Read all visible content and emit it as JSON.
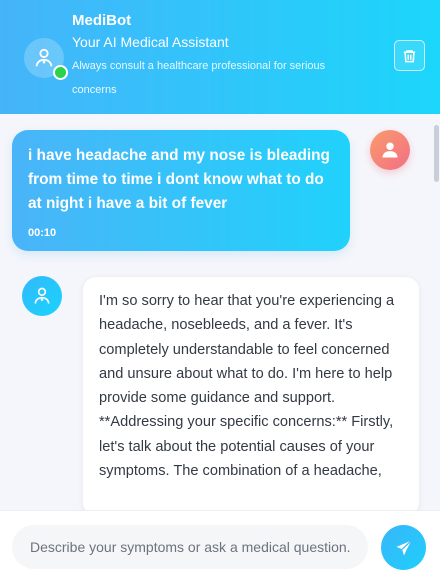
{
  "header": {
    "app_name": "MediBot",
    "subtitle": "Your AI Medical Assistant",
    "disclaimer": "Always consult a healthcare professional for serious concerns",
    "status": "online",
    "clear_icon": "trash-icon"
  },
  "messages": [
    {
      "sender": "user",
      "avatar_icon": "user-icon",
      "text": "i have headache and my nose is bleading from time to time i dont know what to do at night i have a bit of fever",
      "time": "00:10"
    },
    {
      "sender": "bot",
      "avatar_icon": "doctor-icon",
      "text": "I'm so sorry to hear that you're experiencing a headache, nosebleeds, and a fever. It's completely understandable to feel concerned and unsure about what to do. I'm here to help provide some guidance and support. **Addressing your specific concerns:** Firstly, let's talk about the potential causes of your symptoms. The combination of a headache,"
    }
  ],
  "composer": {
    "placeholder": "Describe your symptoms or ask a medical question...",
    "value": "",
    "send_icon": "send-icon"
  },
  "colors": {
    "header_gradient_start": "#45b4f9",
    "header_gradient_end": "#1cd6fb",
    "online": "#2bd24a",
    "user_avatar": "#f58a72",
    "background": "#f5f6fb"
  }
}
